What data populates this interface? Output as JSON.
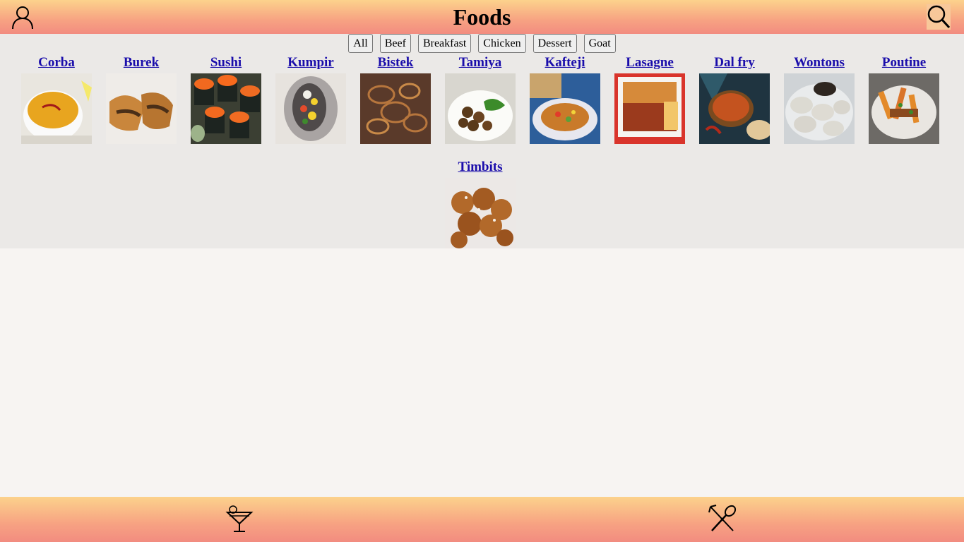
{
  "header": {
    "title": "Foods",
    "user_icon": "user-icon",
    "search_icon": "search-icon"
  },
  "filters": [
    "All",
    "Beef",
    "Breakfast",
    "Chicken",
    "Dessert",
    "Goat"
  ],
  "meals": [
    {
      "name": "Corba",
      "image": "lentil-soup-bowl"
    },
    {
      "name": "Burek",
      "image": "meat-pastry"
    },
    {
      "name": "Sushi",
      "image": "sushi-rolls-with-roe"
    },
    {
      "name": "Kumpir",
      "image": "stuffed-baked-potato"
    },
    {
      "name": "Bistek",
      "image": "beef-steak-with-onions"
    },
    {
      "name": "Tamiya",
      "image": "falafel-plate"
    },
    {
      "name": "Kafteji",
      "image": "vegetable-platter"
    },
    {
      "name": "Lasagne",
      "image": "lasagne-dish"
    },
    {
      "name": "Dal fry",
      "image": "dal-curry-bowl"
    },
    {
      "name": "Wontons",
      "image": "steamed-dumplings"
    },
    {
      "name": "Poutine",
      "image": "fries-with-gravy"
    },
    {
      "name": "Timbits",
      "image": "donut-holes"
    }
  ],
  "footer": {
    "drinks_icon": "cocktail-glass-icon",
    "foods_icon": "fork-spoon-icon"
  },
  "colors": {
    "header_top": "#fcd28c",
    "header_bottom": "#f28c80",
    "link": "#1a0dab",
    "content_bg": "#ebe9e7",
    "page_bg": "#f7f4f2"
  }
}
